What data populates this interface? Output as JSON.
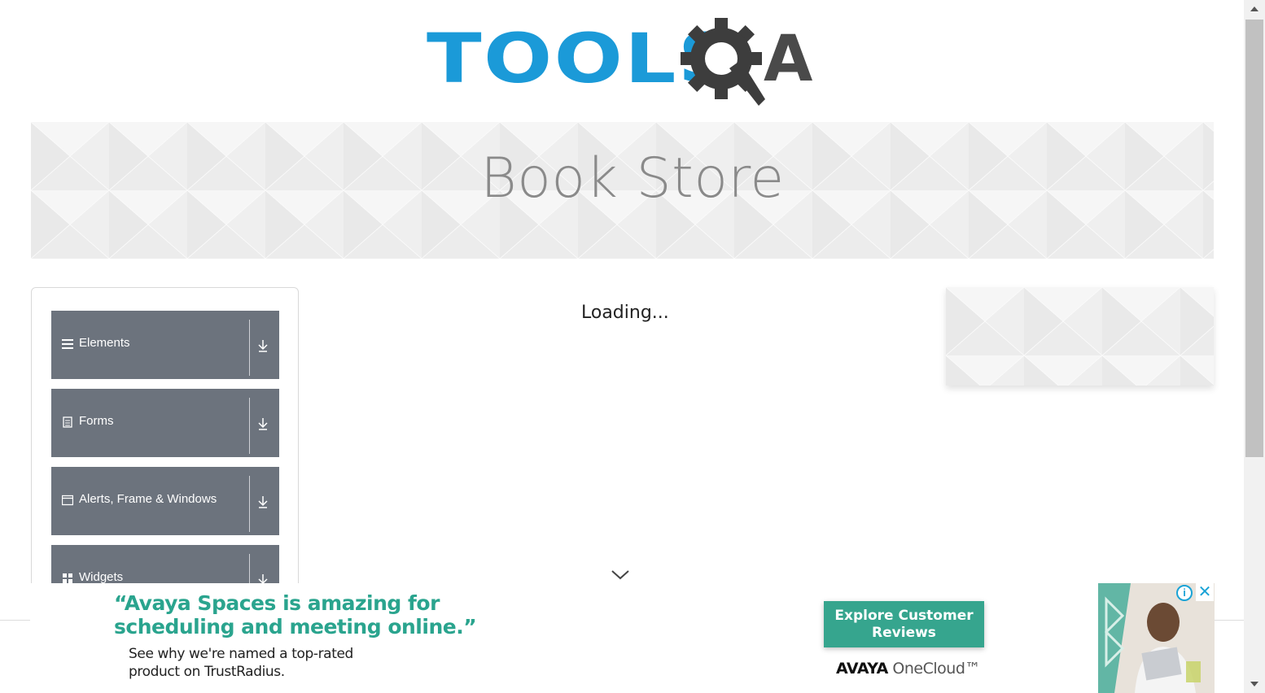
{
  "header": {
    "logo_text": "TOOLS",
    "logo_suffix": "A",
    "logo_alt": "TOOLSQA"
  },
  "banner": {
    "title": "Book Store"
  },
  "nav": {
    "groups": [
      {
        "label": "Elements",
        "icon": "hamburger-icon"
      },
      {
        "label": "Forms",
        "icon": "form-icon"
      },
      {
        "label": "Alerts, Frame & Windows",
        "icon": "window-icon"
      },
      {
        "label": "Widgets",
        "icon": "widgets-icon"
      }
    ]
  },
  "main": {
    "status_text": "Loading..."
  },
  "ad": {
    "quote": "“Avaya Spaces is amazing for scheduling and meeting online.”",
    "subtext": "See why we're named a top-rated product on TrustRadius.",
    "cta_label": "Explore Customer Reviews",
    "brand_primary": "AVAYA",
    "brand_secondary": "OneCloud™",
    "info_label": "i",
    "close_label": "✕"
  },
  "colors": {
    "logo_blue": "#1b9ad8",
    "logo_gray": "#4a4a4a",
    "nav_group_bg": "#6c737d",
    "ad_green": "#2aa48e"
  }
}
